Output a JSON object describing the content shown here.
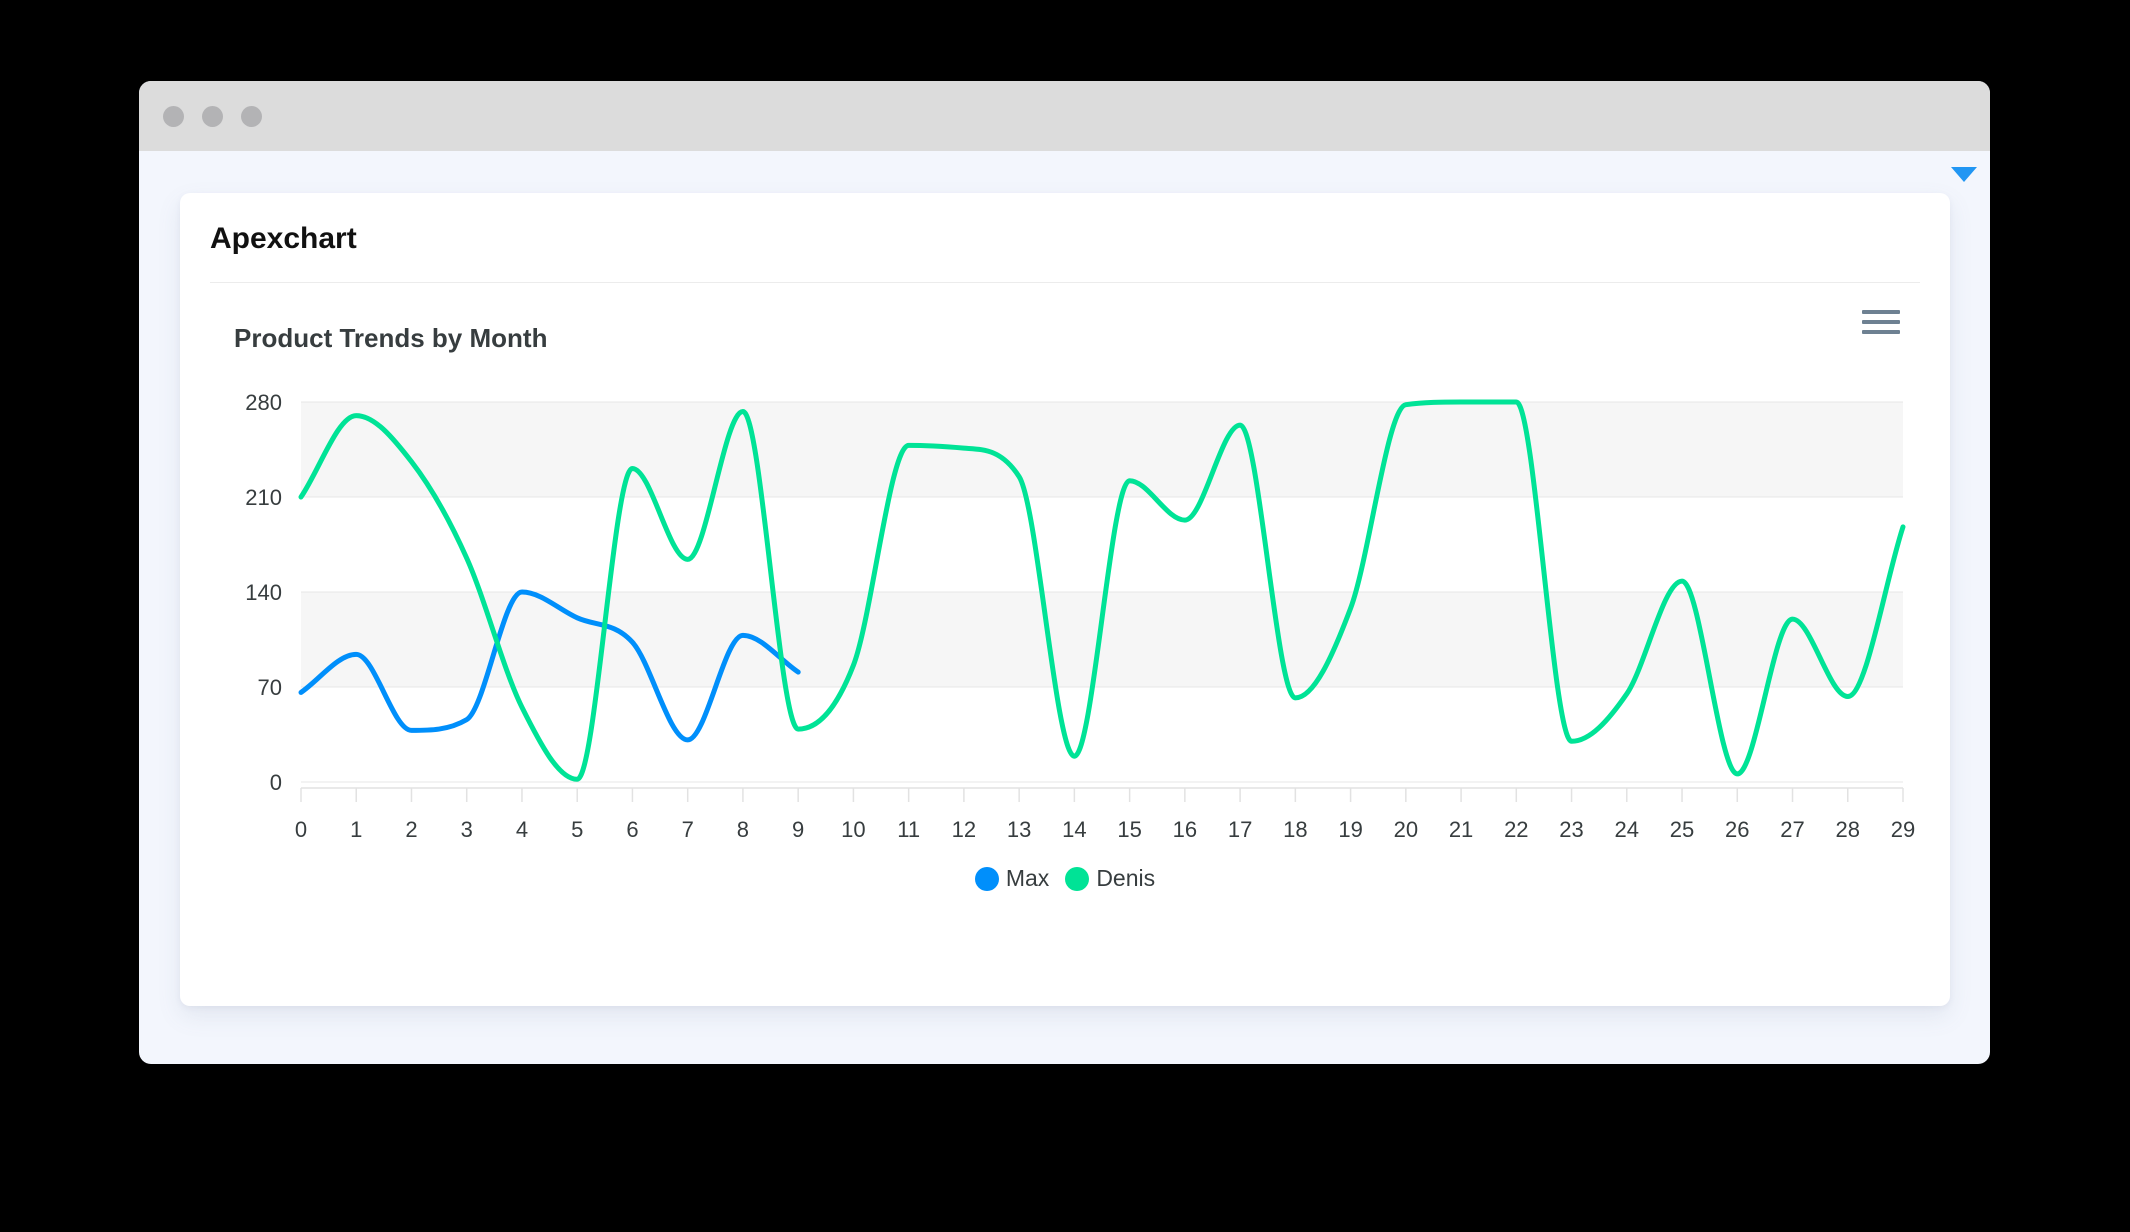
{
  "window": {
    "kind": "browser-window-mockup",
    "traffic_light_count": 3
  },
  "header": {
    "app_title": "Apexchart"
  },
  "chart": {
    "title": "Product Trends by Month"
  },
  "chart_data": {
    "type": "line",
    "curve": "smooth",
    "title": "Product Trends by Month",
    "x": [
      0,
      1,
      2,
      3,
      4,
      5,
      6,
      7,
      8,
      9,
      10,
      11,
      12,
      13,
      14,
      15,
      16,
      17,
      18,
      19,
      20,
      21,
      22,
      23,
      24,
      25,
      26,
      27,
      28,
      29
    ],
    "series": [
      {
        "name": "Max",
        "color": "#008FFB",
        "values": [
          66,
          94,
          38,
          46,
          140,
          121,
          103,
          31,
          108,
          81
        ]
      },
      {
        "name": "Denis",
        "color": "#00E396",
        "values": [
          210,
          270,
          236,
          165,
          55,
          2,
          231,
          164,
          273,
          39,
          86,
          248,
          246,
          225,
          19,
          222,
          193,
          263,
          62,
          128,
          278,
          280,
          280,
          30,
          65,
          148,
          6,
          120,
          63,
          188
        ]
      }
    ],
    "ylim": [
      0,
      280
    ],
    "yticks": [
      0,
      70,
      140,
      210,
      280
    ],
    "xlabel": "",
    "ylabel": "",
    "grid": {
      "row_stripes": true,
      "stripe_color": "#f6f6f6",
      "gridline_color": "#e7e7e7"
    },
    "legend_position": "bottom"
  },
  "ui_colors": {
    "page_bg": "#000000",
    "titlebar": "#dcdcdc",
    "titlebar_dot": "#b3b3b5",
    "window_bg": "#f3f6fd",
    "card_bg": "#ffffff",
    "dropdown_arrow": "#2196f3",
    "menu_icon": "#6e8192",
    "axis_color": "#e2e2e2",
    "label_color": "#373d3f",
    "divider": "#ececec",
    "app_title_color": "#111111"
  }
}
